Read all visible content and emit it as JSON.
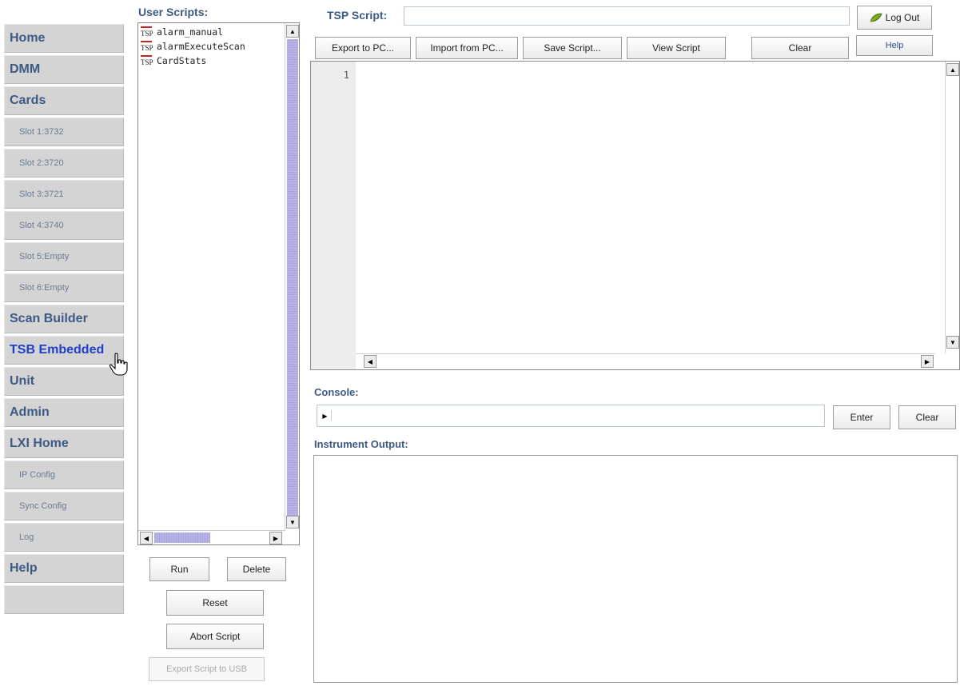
{
  "nav": {
    "home": "Home",
    "dmm": "DMM",
    "cards": "Cards",
    "slot1": "Slot 1:3732",
    "slot2": "Slot 2:3720",
    "slot3": "Slot 3:3721",
    "slot4": "Slot 4:3740",
    "slot5": "Slot 5:Empty",
    "slot6": "Slot 6:Empty",
    "scan_builder": "Scan Builder",
    "tsb_embedded": "TSB Embedded",
    "unit": "Unit",
    "admin": "Admin",
    "lxi_home": "LXI Home",
    "ip_config": "IP Config",
    "sync_config": "Sync Config",
    "log": "Log",
    "help": "Help"
  },
  "scripts": {
    "title": "User Scripts:",
    "icon_text": "TSP",
    "items": [
      "alarm_manual",
      "alarmExecuteScan",
      "CardStats"
    ],
    "run": "Run",
    "delete": "Delete",
    "reset": "Reset",
    "abort": "Abort Script",
    "export_usb": "Export Script to USB"
  },
  "editor": {
    "tsp_label": "TSP Script:",
    "tsp_value": "",
    "logout": "Log Out",
    "help": "Help",
    "export_pc": "Export to PC...",
    "import_pc": "Import from PC...",
    "save_script": "Save Script...",
    "view_script": "View Script",
    "clear": "Clear",
    "line_number": "1"
  },
  "console": {
    "label": "Console:",
    "value": "",
    "enter": "Enter",
    "clear": "Clear"
  },
  "output": {
    "label": "Instrument Output:"
  },
  "colors": {
    "nav_bg": "#d4d4d4",
    "nav_text": "#3d5a85",
    "nav_active": "#1f3fc8",
    "scroll_thumb": "#b7b3e6"
  }
}
